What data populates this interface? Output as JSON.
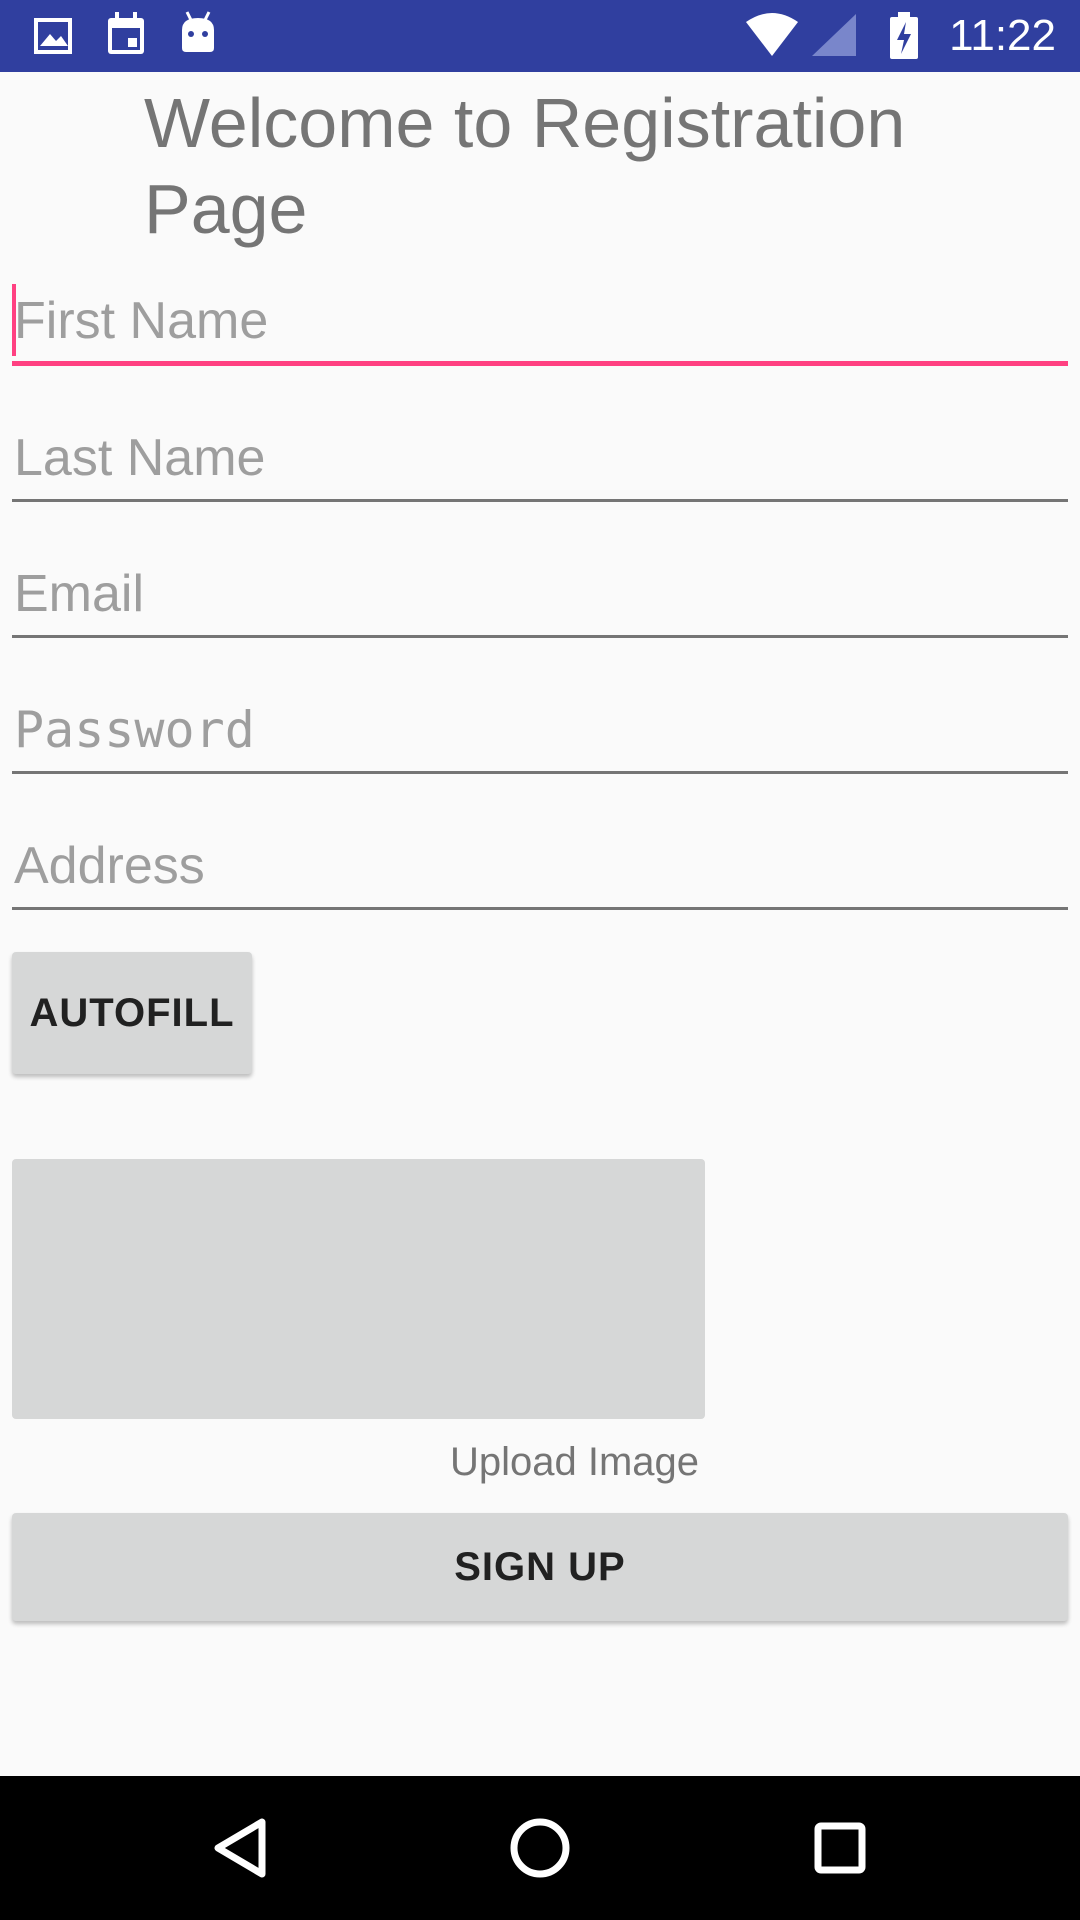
{
  "status_bar": {
    "time": "11:22",
    "left_icons": [
      "image-icon",
      "calendar-icon",
      "android-icon"
    ],
    "right_icons": [
      "wifi-icon",
      "cell-signal-icon",
      "battery-charging-icon"
    ]
  },
  "page": {
    "title": "Welcome to Registration Page"
  },
  "form": {
    "first_name": {
      "placeholder": "First Name",
      "value": ""
    },
    "last_name": {
      "placeholder": "Last Name",
      "value": ""
    },
    "email": {
      "placeholder": "Email",
      "value": ""
    },
    "password": {
      "placeholder": "Password",
      "value": ""
    },
    "address": {
      "placeholder": "Address",
      "value": ""
    }
  },
  "buttons": {
    "autofill_label": "AUTOFILL",
    "signup_label": "SIGN UP"
  },
  "upload": {
    "label": "Upload Image"
  },
  "nav_bar": {
    "icons": [
      "back-icon",
      "home-icon",
      "recents-icon"
    ]
  },
  "colors": {
    "status_bar": "#303f9f",
    "accent": "#ff4081",
    "button_bg": "#d6d7d7",
    "background": "#fafafa",
    "nav_bar": "#000000"
  }
}
